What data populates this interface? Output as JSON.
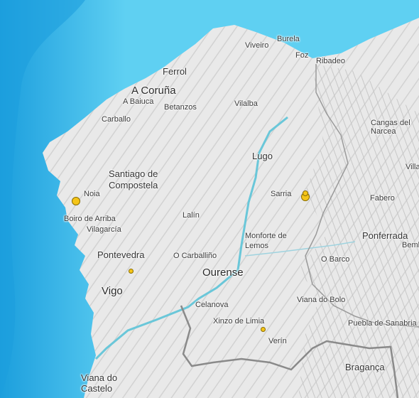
{
  "colors": {
    "deep_sea": "#1c9fdd",
    "shallow_sea": "#5fd0f2",
    "land": "#e9e9e9",
    "relief": "#bdbdbd",
    "border": "#8a8a8a",
    "river": "#6ac7d9",
    "quake_fill": "#f5c518"
  },
  "places": [
    {
      "id": "a-coruna",
      "name": "A Coruña",
      "size": "l"
    },
    {
      "id": "ferrol",
      "name": "Ferrol",
      "size": "m"
    },
    {
      "id": "viveiro",
      "name": "Viveiro",
      "size": "s"
    },
    {
      "id": "burela",
      "name": "Burela",
      "size": "s"
    },
    {
      "id": "foz",
      "name": "Foz",
      "size": "s"
    },
    {
      "id": "ribadeo",
      "name": "Ribadeo",
      "size": "s"
    },
    {
      "id": "a-baiuca",
      "name": "A Baiuca",
      "size": "s"
    },
    {
      "id": "betanzos",
      "name": "Betanzos",
      "size": "s"
    },
    {
      "id": "vilalba",
      "name": "Vilalba",
      "size": "s"
    },
    {
      "id": "carballo",
      "name": "Carballo",
      "size": "s"
    },
    {
      "id": "cangas-del-narcea",
      "name": "Cangas del\nNarcea",
      "size": "s"
    },
    {
      "id": "lugo",
      "name": "Lugo",
      "size": "m"
    },
    {
      "id": "santiago",
      "name": "Santiago de\nCompostela",
      "size": "m"
    },
    {
      "id": "villa",
      "name": "Villa",
      "size": "s"
    },
    {
      "id": "noia",
      "name": "Noia",
      "size": "s"
    },
    {
      "id": "sarria",
      "name": "Sarria",
      "size": "s"
    },
    {
      "id": "fabero",
      "name": "Fabero",
      "size": "s"
    },
    {
      "id": "boiro",
      "name": "Boiro de Arriba",
      "size": "s"
    },
    {
      "id": "vilagarcia",
      "name": "Vilagarcía",
      "size": "s"
    },
    {
      "id": "lalin",
      "name": "Lalín",
      "size": "s"
    },
    {
      "id": "ponferrada",
      "name": "Ponferrada",
      "size": "m"
    },
    {
      "id": "monforte",
      "name": "Monforte de\nLemos",
      "size": "s"
    },
    {
      "id": "pontevedra",
      "name": "Pontevedra",
      "size": "m"
    },
    {
      "id": "o-carballino",
      "name": "O Carballiño",
      "size": "s"
    },
    {
      "id": "o-barco",
      "name": "O Barco",
      "size": "s"
    },
    {
      "id": "bembibre",
      "name": "Bembi",
      "size": "s"
    },
    {
      "id": "ourense",
      "name": "Ourense",
      "size": "l"
    },
    {
      "id": "vigo",
      "name": "Vigo",
      "size": "l"
    },
    {
      "id": "celanova",
      "name": "Celanova",
      "size": "s"
    },
    {
      "id": "viana-do-bolo",
      "name": "Viana do Bolo",
      "size": "s"
    },
    {
      "id": "xinzo",
      "name": "Xinzo de Limia",
      "size": "s"
    },
    {
      "id": "puebla",
      "name": "Puebla de Sanabria",
      "size": "s"
    },
    {
      "id": "verin",
      "name": "Verín",
      "size": "s"
    },
    {
      "id": "braganca",
      "name": "Bragança",
      "size": "m"
    },
    {
      "id": "viana-do-castelo",
      "name": "Viana do\nCastelo",
      "size": "m"
    }
  ],
  "earthquakes": [
    {
      "id": "noia",
      "size": "large"
    },
    {
      "id": "sarria-1",
      "size": "medium"
    },
    {
      "id": "sarria-2",
      "size": "small"
    },
    {
      "id": "pontevedra",
      "size": "small"
    },
    {
      "id": "verin",
      "size": "small"
    }
  ]
}
